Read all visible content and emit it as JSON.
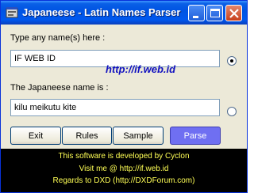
{
  "window": {
    "title": "Japaneese - Latin Names Parser",
    "icon": "app-icon",
    "controls": [
      "minimize-icon",
      "maximize-icon",
      "close-icon"
    ]
  },
  "input": {
    "label": "Type any name(s) here :",
    "value": "IF WEB ID",
    "radio_selected": true
  },
  "watermark": "http://if.web.id",
  "output": {
    "label": "The Japaneese name is :",
    "value": "kilu meikutu kite",
    "radio_selected": false
  },
  "buttons": {
    "exit": "Exit",
    "rules": "Rules",
    "sample": "Sample",
    "parse": "Parse"
  },
  "footer": {
    "line1": "This software is developed by Cyclon",
    "line2": "Visit me @ http://if.web.id",
    "line3": "Regards to DXD (http://DXDForum.com)",
    "text_color": "#ffff55",
    "bg_color": "#000000"
  },
  "colors": {
    "titlebar": "#0054e3",
    "window_bg": "#ece9d8",
    "parse_button": "#6f6ff2"
  }
}
